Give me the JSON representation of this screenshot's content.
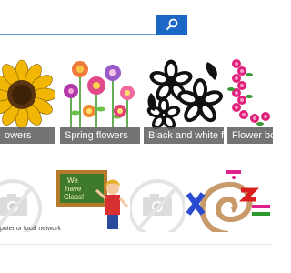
{
  "search": {
    "value": "",
    "placeholder": "",
    "icon": "search-icon",
    "accent": "#1a67c6"
  },
  "results": [
    {
      "caption": "owers",
      "name": "sunflower"
    },
    {
      "caption": "Spring flowers",
      "name": "spring-flowers"
    },
    {
      "caption": "Black and white fl...",
      "name": "black-white-flowers"
    },
    {
      "caption": "Flower bord",
      "name": "flower-border"
    }
  ],
  "second_row": [
    {
      "name": "camera-placeholder"
    },
    {
      "name": "teacher-clipart",
      "board_text": [
        "We",
        "have",
        "Class!"
      ]
    },
    {
      "name": "camera-placeholder"
    },
    {
      "name": "math-symbols"
    }
  ],
  "footer": {
    "text": "puter or local network"
  }
}
